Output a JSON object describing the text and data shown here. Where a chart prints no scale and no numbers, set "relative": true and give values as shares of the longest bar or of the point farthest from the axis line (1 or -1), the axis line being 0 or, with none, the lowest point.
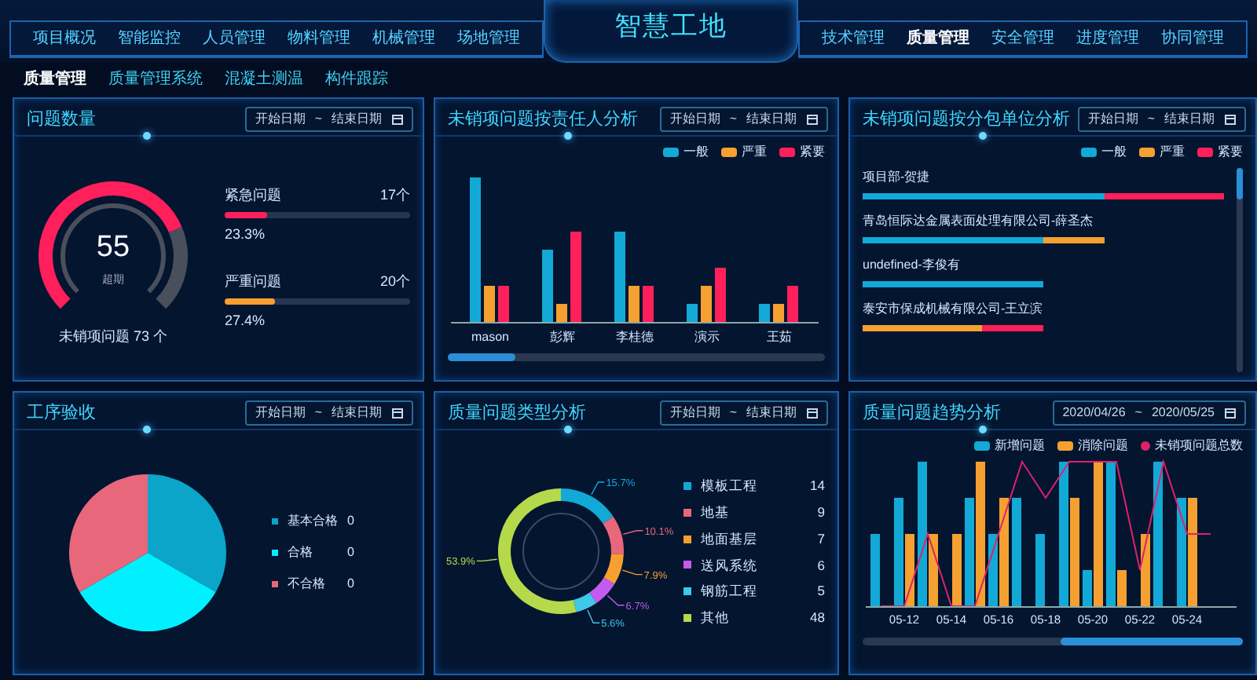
{
  "header": {
    "title": "智慧工地",
    "left_nav": [
      {
        "label": "项目概况",
        "selected": false
      },
      {
        "label": "智能监控",
        "selected": false
      },
      {
        "label": "人员管理",
        "selected": false
      },
      {
        "label": "物料管理",
        "selected": false
      },
      {
        "label": "机械管理",
        "selected": false
      },
      {
        "label": "场地管理",
        "selected": false
      }
    ],
    "right_nav": [
      {
        "label": "技术管理",
        "selected": false
      },
      {
        "label": "质量管理",
        "selected": true
      },
      {
        "label": "安全管理",
        "selected": false
      },
      {
        "label": "进度管理",
        "selected": false
      },
      {
        "label": "协同管理",
        "selected": false
      }
    ]
  },
  "sub_nav": [
    {
      "label": "质量管理",
      "selected": true
    },
    {
      "label": "质量管理系统",
      "selected": false
    },
    {
      "label": "混凝土测温",
      "selected": false
    },
    {
      "label": "构件跟踪",
      "selected": false
    }
  ],
  "issue_count": {
    "title": "问题数量",
    "date_range": {
      "start": "开始日期",
      "separator": "~",
      "end": "结束日期"
    },
    "gauge": {
      "value": "55",
      "caption": "超期",
      "footer": "未销项问题 73 个"
    },
    "bars": [
      {
        "label": "紧急问题",
        "count": "17个",
        "level": 0.233,
        "percent": "23.3%",
        "color": "#ff1f5a"
      },
      {
        "label": "严重问题",
        "count": "20个",
        "level": 0.274,
        "percent": "27.4%",
        "color": "#f5a030"
      }
    ]
  },
  "owner_analysis": {
    "title": "未销项问题按责任人分析",
    "date_range": {
      "start": "开始日期",
      "separator": "~",
      "end": "结束日期"
    },
    "legend": [
      {
        "label": "一般",
        "color": "#12a9d6"
      },
      {
        "label": "严重",
        "color": "#f5a030"
      },
      {
        "label": "紧要",
        "color": "#ff1f5a"
      }
    ],
    "categories": [
      "mason",
      "彭辉",
      "李桂德",
      "演示",
      "王茹"
    ]
  },
  "unit_analysis": {
    "title": "未销项问题按分包单位分析",
    "date_range": {
      "start": "开始日期",
      "separator": "~",
      "end": "结束日期"
    },
    "legend": [
      {
        "label": "一般",
        "color": "#12a9d6"
      },
      {
        "label": "严重",
        "color": "#f5a030"
      },
      {
        "label": "紧要",
        "color": "#ff1f5a"
      }
    ],
    "rows": [
      "项目部-贺捷",
      "青岛恒际达金属表面处理有限公司-薛圣杰",
      "undefined-李俊有",
      "泰安市保成机械有限公司-王立滨"
    ]
  },
  "acceptance": {
    "title": "工序验收",
    "date_range": {
      "start": "开始日期",
      "separator": "~",
      "end": "结束日期"
    },
    "legend": [
      {
        "label": "基本合格",
        "value": "0",
        "color": "#0aa5c9"
      },
      {
        "label": "合格",
        "value": "0",
        "color": "#00f0ff"
      },
      {
        "label": "不合格",
        "value": "0",
        "color": "#e8677a"
      }
    ]
  },
  "quality_types": {
    "title": "质量问题类型分析",
    "date_range": {
      "start": "开始日期",
      "separator": "~",
      "end": "结束日期"
    },
    "legend": [
      {
        "value": "14",
        "color": "#12a9d6"
      },
      {
        "value": "9",
        "color": "#e8677a"
      },
      {
        "value": "7",
        "color": "#f5a030"
      },
      {
        "value": "6",
        "color": "#c45bf0"
      },
      {
        "value": "5",
        "color": "#3fc8e8"
      },
      {
        "value": "48",
        "color": "#b5d94a"
      }
    ],
    "chart_data": {
      "type": "donut",
      "categories": [
        "模板工程",
        "地基",
        "地面基层",
        "送风系统",
        "钢筋工程",
        "其他"
      ],
      "values": [
        15.7,
        10.1,
        7.9,
        6.7,
        5.6,
        53.9
      ],
      "value_labels": [
        "15.7%",
        "10.1%",
        "7.9%",
        "6.7%",
        "5.6%",
        "53.9%"
      ]
    }
  },
  "trend": {
    "title": "质量问题趋势分析",
    "date_range": {
      "start": "2020/04/26",
      "separator": "~",
      "end": "2020/05/25"
    },
    "chart_data": {
      "type": "bar",
      "relative": true,
      "legend": "top-right",
      "categories": [
        null,
        "05-12",
        null,
        "05-14",
        null,
        "05-16",
        null,
        "05-18",
        null,
        "05-20",
        null,
        "05-22",
        null,
        "05-24",
        null
      ],
      "series": [
        {
          "name": "新增问题",
          "color": "#12a9d6",
          "values": [
            0.5,
            0.75,
            1,
            0,
            0.75,
            0.5,
            0.75,
            0.5,
            1,
            0.25,
            1,
            0,
            1,
            0.75,
            0
          ]
        },
        {
          "name": "消除问题",
          "color": "#f5a030",
          "values": [
            0,
            0.5,
            0.5,
            0.5,
            1,
            0.75,
            0,
            0,
            0.75,
            1,
            0.25,
            0.5,
            0,
            0.75,
            0
          ]
        },
        {
          "name": "未销项问题总数",
          "color": "#e0206a",
          "type": "line",
          "values": [
            0,
            0,
            0.5,
            0,
            0,
            0.5,
            1,
            0.75,
            1,
            1,
            1,
            0.25,
            1,
            0.5,
            0.5
          ]
        }
      ]
    }
  }
}
